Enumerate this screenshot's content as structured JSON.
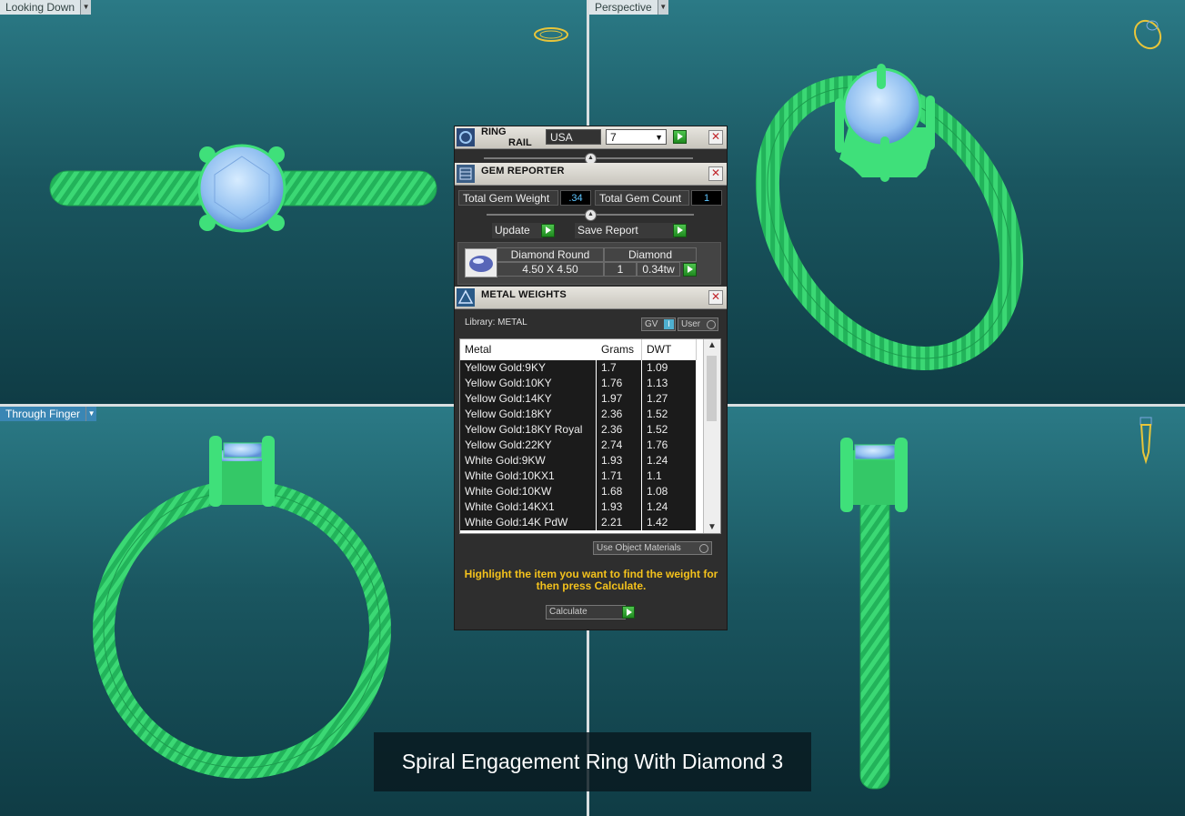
{
  "viewports": {
    "top_left": {
      "label": "Looking Down"
    },
    "top_right": {
      "label": "Perspective"
    },
    "bottom_left": {
      "label": "Through Finger"
    }
  },
  "ring_rail": {
    "title_line1": "RING",
    "title_line2": "RAIL",
    "standard": "USA",
    "size": "7"
  },
  "gem_reporter": {
    "title": "GEM REPORTER",
    "total_weight_label": "Total Gem Weight",
    "total_weight_value": ".34",
    "total_count_label": "Total Gem Count",
    "total_count_value": "1",
    "update_label": "Update",
    "save_report_label": "Save Report",
    "gem": {
      "shape": "Diamond Round",
      "material": "Diamond",
      "size": "4.50 X 4.50",
      "qty": "1",
      "weight": "0.34tw"
    }
  },
  "metal_weights": {
    "title": "METAL WEIGHTS",
    "library_label": "Library: METAL",
    "gv_label": "GV",
    "user_label": "User",
    "columns": [
      "Metal",
      "Grams",
      "DWT"
    ],
    "rows": [
      [
        "Yellow Gold:9KY",
        "1.7",
        "1.09"
      ],
      [
        "Yellow Gold:10KY",
        "1.76",
        "1.13"
      ],
      [
        "Yellow Gold:14KY",
        "1.97",
        "1.27"
      ],
      [
        "Yellow Gold:18KY",
        "2.36",
        "1.52"
      ],
      [
        "Yellow Gold:18KY Royal",
        "2.36",
        "1.52"
      ],
      [
        "Yellow Gold:22KY",
        "2.74",
        "1.76"
      ],
      [
        "White Gold:9KW",
        "1.93",
        "1.24"
      ],
      [
        "White Gold:10KX1",
        "1.71",
        "1.1"
      ],
      [
        "White Gold:10KW",
        "1.68",
        "1.08"
      ],
      [
        "White Gold:14KX1",
        "1.93",
        "1.24"
      ],
      [
        "White Gold:14K PdW",
        "2.21",
        "1.42"
      ]
    ],
    "use_object_materials_label": "Use Object Materials",
    "hint": "Highlight the item you want to find the weight for then press Calculate.",
    "calculate_label": "Calculate"
  },
  "caption": "Spiral Engagement Ring With Diamond 3",
  "colors": {
    "ring_green": "#3fe07a",
    "gem_blue": "#9cc8f4",
    "viewport_top": "#2b7a86",
    "viewport_bottom": "#0f3c45",
    "hint_yellow": "#f4c21c"
  }
}
